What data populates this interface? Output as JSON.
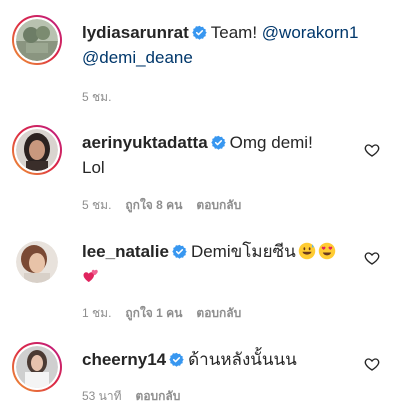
{
  "colors": {
    "username": "#262626",
    "mention": "#00376b",
    "meta": "#8e8e8e",
    "verified": "#3897f0",
    "story_ring": "#dc2743"
  },
  "comments": [
    {
      "username": "lydiasarunrat",
      "text_prefix": "Team! ",
      "mention1": "@worakorn1",
      "mention2": "@demi_deane",
      "time": "5 ชม.",
      "icon": "verified-badge-icon"
    },
    {
      "username": "aerinyuktadatta",
      "text_line1": "Omg demi!",
      "text_line2": "Lol",
      "time": "5 ชม.",
      "likes": "ถูกใจ 8 คน",
      "reply": "ตอบกลับ",
      "icon": "heart-outline-icon"
    },
    {
      "username": "lee_natalie",
      "text": "Demiขโมยซีน",
      "emojis": [
        "grinning-sweat-emoji",
        "heart-eyes-emoji",
        "two-hearts-emoji"
      ],
      "time": "1 ชม.",
      "likes": "ถูกใจ 1 คน",
      "reply": "ตอบกลับ",
      "icon": "heart-outline-icon"
    },
    {
      "username": "cheerny14",
      "text": "ด้านหลังนั้นนน",
      "time": "53 นาที",
      "reply": "ตอบกลับ",
      "icon": "heart-outline-icon"
    }
  ]
}
